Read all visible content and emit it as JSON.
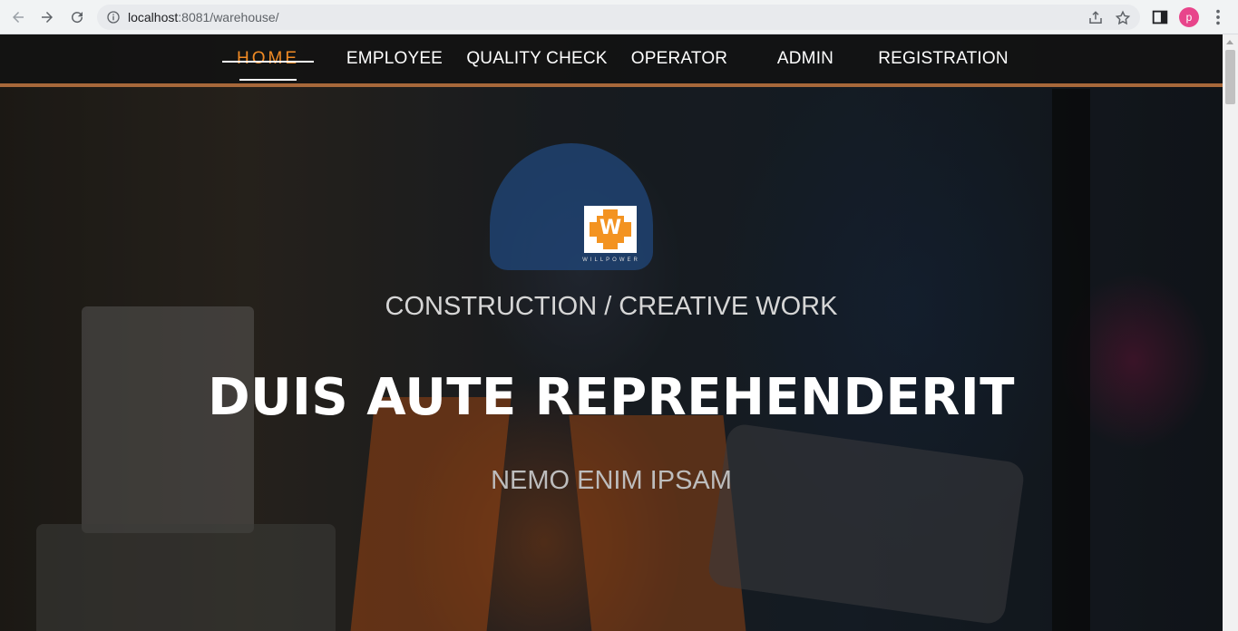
{
  "browser": {
    "url_host": "localhost",
    "url_rest": ":8081/warehouse/",
    "profile_initial": "p"
  },
  "nav": {
    "items": [
      {
        "label": "HOME",
        "active": true
      },
      {
        "label": "EMPLOYEE",
        "active": false
      },
      {
        "label": "QUALITY CHECK",
        "active": false
      },
      {
        "label": "OPERATOR",
        "active": false
      },
      {
        "label": "ADMIN",
        "active": false
      },
      {
        "label": "REGISTRATION",
        "active": false
      }
    ]
  },
  "hero": {
    "logo_letter": "W",
    "logo_text": "WILLPOWER",
    "kicker": "CONSTRUCTION / CREATIVE WORK",
    "headline": "DUIS AUTE REPREHENDERIT",
    "subheadline": "NEMO ENIM IPSAM"
  },
  "colors": {
    "accent": "#f08a24",
    "nav_border": "#a7683a",
    "logo_orange": "#f39321"
  }
}
